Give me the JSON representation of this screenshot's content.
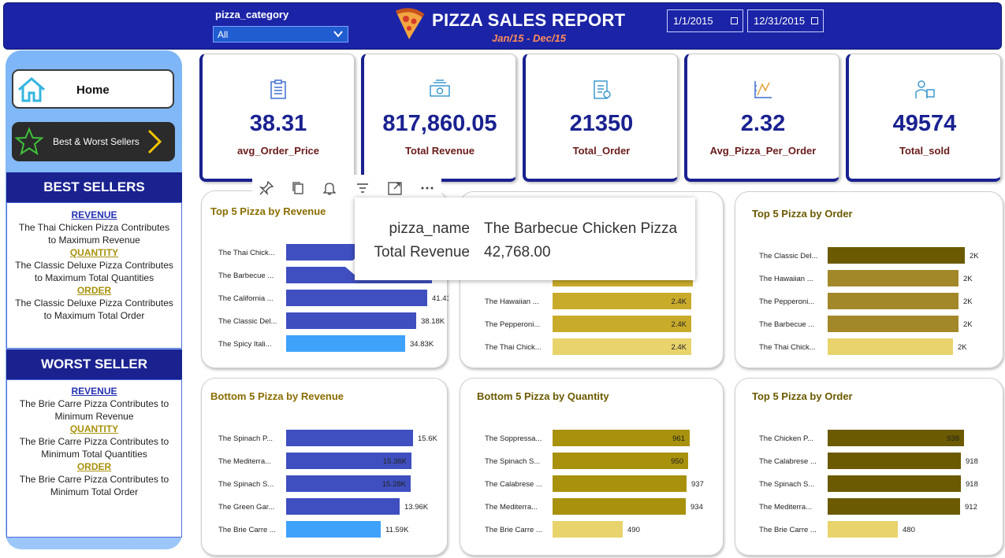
{
  "header": {
    "slicer_label": "pizza_category",
    "slicer_value": "All",
    "title": "PIZZA SALES REPORT",
    "subtitle": "Jan/15 - Dec/15",
    "date_start": "1/1/2015",
    "date_end": "12/31/2015"
  },
  "nav": {
    "home_label": "Home",
    "best_worst_label": "Best & Worst Sellers"
  },
  "best": {
    "heading": "BEST SELLERS",
    "rev_key": "REVENUE",
    "rev_text": "The Thai Chicken Pizza Contributes to Maximum Revenue",
    "qty_key": "QUANTITY",
    "qty_text": "The Classic Deluxe Pizza  Contributes to Maximum Total Quantities",
    "ord_key": "ORDER",
    "ord_text": "The Classic Deluxe Pizza Contributes to Maximum Total Order"
  },
  "worst": {
    "heading": "WORST SELLER",
    "rev_key": "REVENUE",
    "rev_text": "The Brie Carre Pizza Contributes to Minimum Revenue",
    "qty_key": "QUANTITY",
    "qty_text": "The Brie Carre Pizza  Contributes to Minimum Total Quantities",
    "ord_key": "ORDER",
    "ord_text": "The Brie Carre Pizza Contributes to Minimum Total Order"
  },
  "kpis": [
    {
      "value": "38.31",
      "label": "avg_Order_Price",
      "icon": "clipboard-icon"
    },
    {
      "value": "817,860.05",
      "label": "Total Revenue",
      "icon": "money-icon"
    },
    {
      "value": "21350",
      "label": "Total_Order",
      "icon": "order-list-icon"
    },
    {
      "value": "2.32",
      "label": "Avg_Pizza_Per_Order",
      "icon": "chart-icon"
    },
    {
      "value": "49574",
      "label": "Total_sold",
      "icon": "delivery-icon"
    }
  ],
  "tooltip": {
    "k1": "pizza_name",
    "v1": "The Barbecue Chicken Pizza",
    "k2": "Total Revenue",
    "v2": "42,768.00"
  },
  "colors": {
    "navy": "#1a2290",
    "blue_bar": "#3f4fbf",
    "blue_min": "#3ea2fb",
    "gold_bar": "#c9ab2c",
    "gold_dark": "#a8910d",
    "olive_bar": "#6b5a00",
    "pale": "#e8d36c"
  },
  "chart_data": [
    {
      "type": "bar",
      "title": "Top 5 Pizza by Revenue",
      "categories": [
        "The Thai Chick...",
        "The Barbecue ...",
        "The California ...",
        "The Classic Del...",
        "The Spicy Itali..."
      ],
      "values": [
        43.43,
        42.77,
        41.41,
        38.18,
        34.83
      ],
      "labels": [
        "",
        "",
        "41.41K",
        "38.18K",
        "34.83K"
      ]
    },
    {
      "type": "bar",
      "title": "",
      "categories": [
        "",
        "",
        "The Hawaiian ...",
        "The Pepperoni...",
        "The Thai Chick..."
      ],
      "values": [
        2.45,
        2.42,
        2.4,
        2.4,
        2.4
      ],
      "labels": [
        "",
        "",
        "2.4K",
        "2.4K",
        "2.4K"
      ]
    },
    {
      "type": "bar",
      "title": "Top 5 Pizza by Order",
      "categories": [
        "The Classic Del...",
        "The Hawaiian ...",
        "The Pepperoni...",
        "The Barbecue ...",
        "The Thai Chick..."
      ],
      "values": [
        2.06,
        1.96,
        1.96,
        1.96,
        1.88
      ],
      "labels": [
        "2K",
        "2K",
        "2K",
        "2K",
        "2K"
      ]
    },
    {
      "type": "bar",
      "title": "Bottom 5 Pizza by Revenue",
      "categories": [
        "The Spinach P...",
        "The Mediterra...",
        "The Spinach S...",
        "The Green Gar...",
        "The Brie Carre ..."
      ],
      "values": [
        15.6,
        15.36,
        15.28,
        13.96,
        11.59
      ],
      "labels": [
        "15.6K",
        "15.36K",
        "15.28K",
        "13.96K",
        "11.59K"
      ]
    },
    {
      "type": "bar",
      "title": "Bottom 5 Pizza by Quantity",
      "categories": [
        "The Soppressa...",
        "The Spinach S...",
        "The Calabrese ...",
        "The Mediterra...",
        "The Brie Carre ..."
      ],
      "values": [
        961,
        950,
        937,
        934,
        490
      ],
      "labels": [
        "961",
        "950",
        "937",
        "934",
        "490"
      ]
    },
    {
      "type": "bar",
      "title": "Top 5 Pizza by Order",
      "categories": [
        "The Chicken P...",
        "The Calabrese ...",
        "The Spinach S...",
        "The Mediterra...",
        "The Brie Carre ..."
      ],
      "values": [
        938,
        918,
        918,
        912,
        480
      ],
      "labels": [
        "938",
        "918",
        "918",
        "912",
        "480"
      ]
    }
  ]
}
